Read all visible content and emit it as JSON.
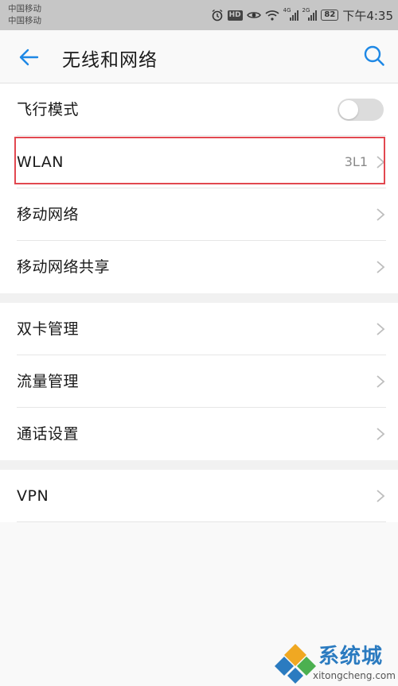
{
  "status_bar": {
    "carrier_1": "中国移动",
    "carrier_2": "中国移动",
    "net_1": "4G",
    "net_2": "2G",
    "battery": "82",
    "time": "下午4:35"
  },
  "header": {
    "title": "无线和网络",
    "back_icon": "arrow-left-icon",
    "search_icon": "search-icon"
  },
  "settings": {
    "group1": [
      {
        "label": "飞行模式",
        "control": "toggle",
        "toggle_on": false
      },
      {
        "label": "WLAN",
        "value": "3L1"
      },
      {
        "label": "移动网络"
      },
      {
        "label": "移动网络共享"
      }
    ],
    "group2": [
      {
        "label": "双卡管理"
      },
      {
        "label": "流量管理"
      },
      {
        "label": "通话设置"
      }
    ],
    "group3": [
      {
        "label": "VPN"
      }
    ]
  },
  "watermark": {
    "name": "系统城",
    "url": "xitongcheng.com"
  },
  "colors": {
    "accent": "#1e88e5",
    "highlight": "#e24850",
    "status_bar": "#c6c6c6"
  }
}
